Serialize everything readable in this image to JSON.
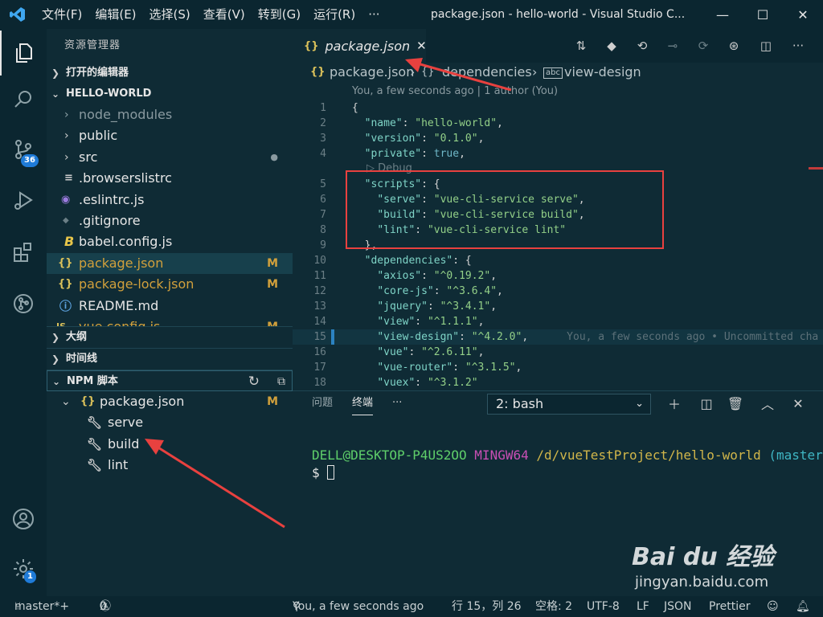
{
  "titlebar": {
    "menus": [
      "文件(F)",
      "编辑(E)",
      "选择(S)",
      "查看(V)",
      "转到(G)",
      "运行(R)",
      "···"
    ],
    "title": "package.json - hello-world - Visual Studio C...",
    "minimize": "—",
    "maximize": "☐",
    "close": "✕"
  },
  "activity": {
    "scm_badge": "36",
    "settings_badge": "1"
  },
  "sidebar": {
    "title": "资源管理器",
    "open_editors": "打开的编辑器",
    "project": "HELLO-WORLD",
    "files": [
      {
        "name": "node_modules",
        "icon": "›",
        "status": ""
      },
      {
        "name": "public",
        "icon": "›",
        "status": ""
      },
      {
        "name": "src",
        "icon": "›",
        "status": "●"
      },
      {
        "name": ".browserslistrc",
        "icon": "≡",
        "status": ""
      },
      {
        "name": ".eslintrc.js",
        "icon": "◉",
        "status": ""
      },
      {
        "name": ".gitignore",
        "icon": "◆",
        "status": ""
      },
      {
        "name": "babel.config.js",
        "icon": "B",
        "status": ""
      },
      {
        "name": "package.json",
        "icon": "{}",
        "status": "M"
      },
      {
        "name": "package-lock.json",
        "icon": "{}",
        "status": "M"
      },
      {
        "name": "README.md",
        "icon": "ⓘ",
        "status": ""
      },
      {
        "name": "vue.config.js",
        "icon": "JS",
        "status": "M"
      }
    ],
    "outline": "大纲",
    "timeline": "时间线",
    "npm": "NPM 脚本",
    "npm_package": "package.json",
    "npm_package_status": "M",
    "scripts": [
      "serve",
      "build",
      "lint"
    ]
  },
  "tab": {
    "icon": "{}",
    "name": "package.json",
    "close": "✕"
  },
  "breadcrumb": {
    "file": "package.json",
    "sep1": "›",
    "node1": "dependencies",
    "sep2": "›",
    "node2": "view-design"
  },
  "editor": {
    "codelens": "You, a few seconds ago | 1 author (You)",
    "debug_lens": "▷ Debug",
    "blame": "You, a few seconds ago • Uncommitted cha",
    "lines": [
      {
        "n": "1",
        "parts": [
          [
            "p",
            "{"
          ]
        ]
      },
      {
        "n": "2",
        "parts": [
          [
            "p",
            "  "
          ],
          [
            "k",
            "\"name\""
          ],
          [
            "p",
            ": "
          ],
          [
            "s",
            "\"hello-world\""
          ],
          [
            "p",
            ","
          ]
        ]
      },
      {
        "n": "3",
        "parts": [
          [
            "p",
            "  "
          ],
          [
            "k",
            "\"version\""
          ],
          [
            "p",
            ": "
          ],
          [
            "s",
            "\"0.1.0\""
          ],
          [
            "p",
            ","
          ]
        ]
      },
      {
        "n": "4",
        "parts": [
          [
            "p",
            "  "
          ],
          [
            "k",
            "\"private\""
          ],
          [
            "p",
            ": "
          ],
          [
            "b",
            "true"
          ],
          [
            "p",
            ","
          ]
        ]
      },
      {
        "n": "5",
        "parts": [
          [
            "p",
            "  "
          ],
          [
            "k",
            "\"scripts\""
          ],
          [
            "p",
            ": {"
          ]
        ]
      },
      {
        "n": "6",
        "parts": [
          [
            "p",
            "    "
          ],
          [
            "k",
            "\"serve\""
          ],
          [
            "p",
            ": "
          ],
          [
            "s",
            "\"vue-cli-service serve\""
          ],
          [
            "p",
            ","
          ]
        ]
      },
      {
        "n": "7",
        "parts": [
          [
            "p",
            "    "
          ],
          [
            "k",
            "\"build\""
          ],
          [
            "p",
            ": "
          ],
          [
            "s",
            "\"vue-cli-service build\""
          ],
          [
            "p",
            ","
          ]
        ]
      },
      {
        "n": "8",
        "parts": [
          [
            "p",
            "    "
          ],
          [
            "k",
            "\"lint\""
          ],
          [
            "p",
            ": "
          ],
          [
            "s",
            "\"vue-cli-service lint\""
          ]
        ]
      },
      {
        "n": "9",
        "parts": [
          [
            "p",
            "  },"
          ]
        ]
      },
      {
        "n": "10",
        "parts": [
          [
            "p",
            "  "
          ],
          [
            "k",
            "\"dependencies\""
          ],
          [
            "p",
            ": {"
          ]
        ]
      },
      {
        "n": "11",
        "parts": [
          [
            "p",
            "    "
          ],
          [
            "k",
            "\"axios\""
          ],
          [
            "p",
            ": "
          ],
          [
            "s",
            "\"^0.19.2\""
          ],
          [
            "p",
            ","
          ]
        ]
      },
      {
        "n": "12",
        "parts": [
          [
            "p",
            "    "
          ],
          [
            "k",
            "\"core-js\""
          ],
          [
            "p",
            ": "
          ],
          [
            "s",
            "\"^3.6.4\""
          ],
          [
            "p",
            ","
          ]
        ]
      },
      {
        "n": "13",
        "parts": [
          [
            "p",
            "    "
          ],
          [
            "k",
            "\"jquery\""
          ],
          [
            "p",
            ": "
          ],
          [
            "s",
            "\"^3.4.1\""
          ],
          [
            "p",
            ","
          ]
        ]
      },
      {
        "n": "14",
        "parts": [
          [
            "p",
            "    "
          ],
          [
            "k",
            "\"view\""
          ],
          [
            "p",
            ": "
          ],
          [
            "s",
            "\"^1.1.1\""
          ],
          [
            "p",
            ","
          ]
        ]
      },
      {
        "n": "15",
        "parts": [
          [
            "p",
            "    "
          ],
          [
            "k",
            "\"view-design\""
          ],
          [
            "p",
            ": "
          ],
          [
            "s",
            "\"^4.2.0\""
          ],
          [
            "p",
            ","
          ]
        ]
      },
      {
        "n": "16",
        "parts": [
          [
            "p",
            "    "
          ],
          [
            "k",
            "\"vue\""
          ],
          [
            "p",
            ": "
          ],
          [
            "s",
            "\"^2.6.11\""
          ],
          [
            "p",
            ","
          ]
        ]
      },
      {
        "n": "17",
        "parts": [
          [
            "p",
            "    "
          ],
          [
            "k",
            "\"vue-router\""
          ],
          [
            "p",
            ": "
          ],
          [
            "s",
            "\"^3.1.5\""
          ],
          [
            "p",
            ","
          ]
        ]
      },
      {
        "n": "18",
        "parts": [
          [
            "p",
            "    "
          ],
          [
            "k",
            "\"vuex\""
          ],
          [
            "p",
            ": "
          ],
          [
            "s",
            "\"^3.1.2\""
          ]
        ]
      }
    ]
  },
  "panel": {
    "problems": "问题",
    "terminal": "终端",
    "more": "···",
    "dropdown": "2: bash",
    "prompt_user": "DELL@DESKTOP-P4US2OO",
    "prompt_env": "MINGW64",
    "prompt_path": "/d/vueTestProject/hello-world",
    "prompt_branch": "(master)",
    "prompt_symbol": "$"
  },
  "status": {
    "branch": "master*+",
    "errors": "0",
    "warnings": "0",
    "blame": "You, a few seconds ago",
    "position": "行 15，列 26",
    "spaces": "空格: 2",
    "encoding": "UTF-8",
    "eol": "LF",
    "language": "JSON",
    "formatter": "Prettier"
  },
  "watermark": {
    "logo": "Bai du 经验",
    "url": "jingyan.baidu.com"
  },
  "colors": {
    "annotation_red": "#e8413f",
    "modified": "#d1a03c",
    "json_key": "#7fd4c7",
    "json_string": "#93d088"
  }
}
